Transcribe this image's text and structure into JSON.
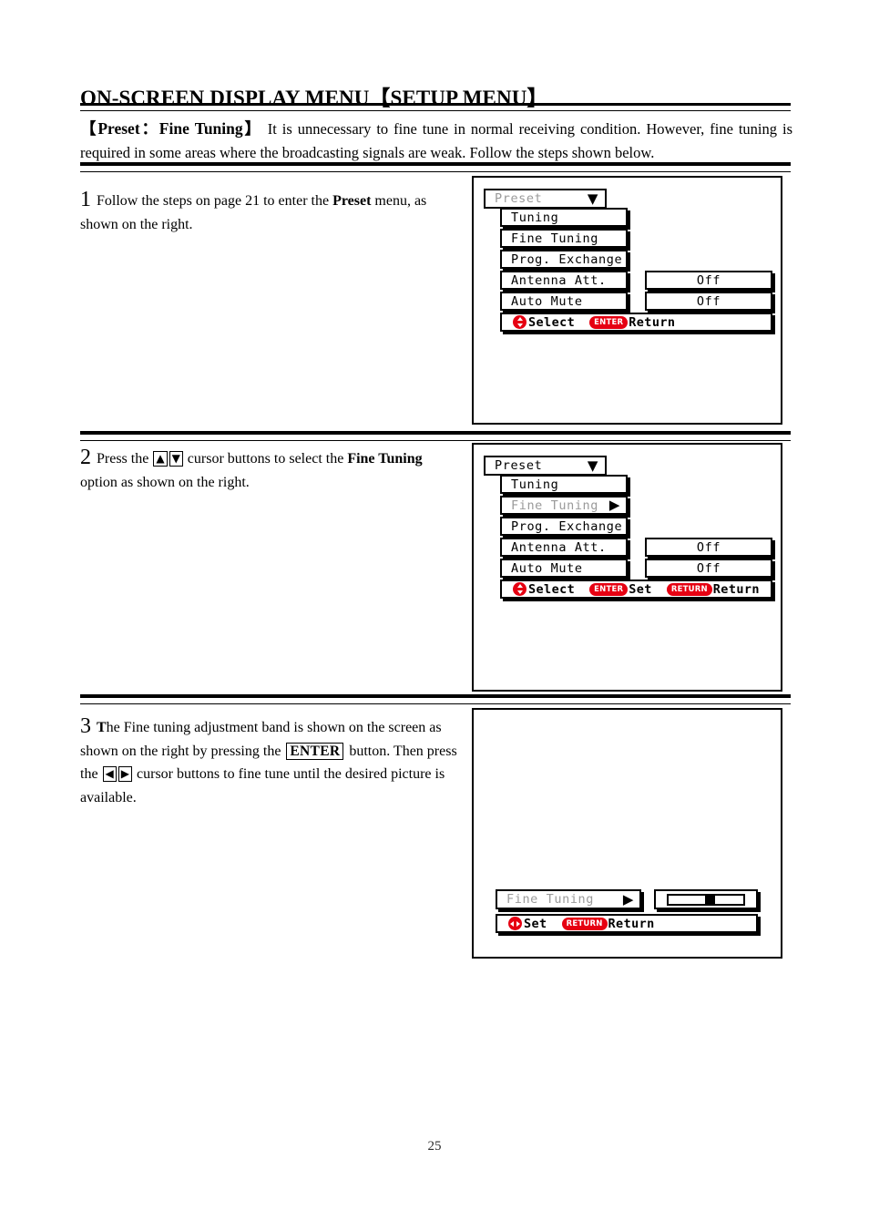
{
  "document": {
    "title": "ON-SCREEN DISPLAY MENU【SETUP MENU】",
    "intro_bold": "【Preset：Fine Tuning】",
    "intro_text": " It is unnecessary to fine tune in normal receiving condition. However, fine tuning is required in some areas where the broadcasting signals are weak. Follow the steps shown below.",
    "page_number": "25"
  },
  "steps": [
    {
      "number": "1",
      "text_before": "Follow the steps on page 21 to enter the ",
      "bold_word": "Preset",
      "text_after": " menu, as shown on the right."
    },
    {
      "number": "2",
      "text_before": "Press the ",
      "key_up": "▲",
      "key_down": "▼",
      "text_mid": " cursor buttons to select the ",
      "bold_word": "Fine Tuning",
      "text_after": " option as shown on the right."
    },
    {
      "number": "3",
      "text_a": "The Fine tuning adjustment band is shown on the screen as shown on the right by pressing the ",
      "key_enter": "ENTER",
      "text_b": " button. Then press the ",
      "key_left": "◀",
      "key_right": "▶",
      "text_c": " cursor buttons to fine tune until the desired picture is available."
    }
  ],
  "osd": {
    "colors": {
      "red": "#e60012",
      "dim_text": "#9a9a9a",
      "border": "#000000",
      "background": "#ffffff"
    },
    "panel1": {
      "header": {
        "label": "Preset",
        "caret": "▼",
        "state": "dim"
      },
      "rows": [
        {
          "label": "Tuning",
          "value": ""
        },
        {
          "label": "Fine Tuning",
          "value": ""
        },
        {
          "label": "Prog. Exchange",
          "value": ""
        },
        {
          "label": "Antenna Att.",
          "value": "Off"
        },
        {
          "label": "Auto Mute",
          "value": "Off"
        }
      ],
      "footer": [
        {
          "icon": "dpad-updown-icon",
          "label": "Select"
        },
        {
          "icon": "enter-badge-icon",
          "badge": "ENTER",
          "label": "Return"
        }
      ]
    },
    "panel2": {
      "header": {
        "label": "Preset",
        "caret": "▼",
        "state": "normal"
      },
      "rows": [
        {
          "label": "Tuning",
          "value": ""
        },
        {
          "label": "Fine Tuning",
          "value": "",
          "state": "dim",
          "caret": "▶"
        },
        {
          "label": "Prog. Exchange",
          "value": ""
        },
        {
          "label": "Antenna Att.",
          "value": "Off"
        },
        {
          "label": "Auto Mute",
          "value": "Off"
        }
      ],
      "footer": [
        {
          "icon": "dpad-updown-icon",
          "label": "Select"
        },
        {
          "icon": "enter-badge-icon",
          "badge": "ENTER",
          "label": "Set"
        },
        {
          "icon": "return-badge-icon",
          "badge": "RETURN",
          "label": "Return"
        }
      ]
    },
    "panel3": {
      "row": {
        "label": "Fine Tuning",
        "caret": "▶",
        "state": "dim"
      },
      "band": {
        "position_percent": 56
      },
      "footer": [
        {
          "icon": "dpad-leftright-icon",
          "label": "Set"
        },
        {
          "icon": "return-badge-icon",
          "badge": "RETURN",
          "label": "Return"
        }
      ]
    }
  }
}
